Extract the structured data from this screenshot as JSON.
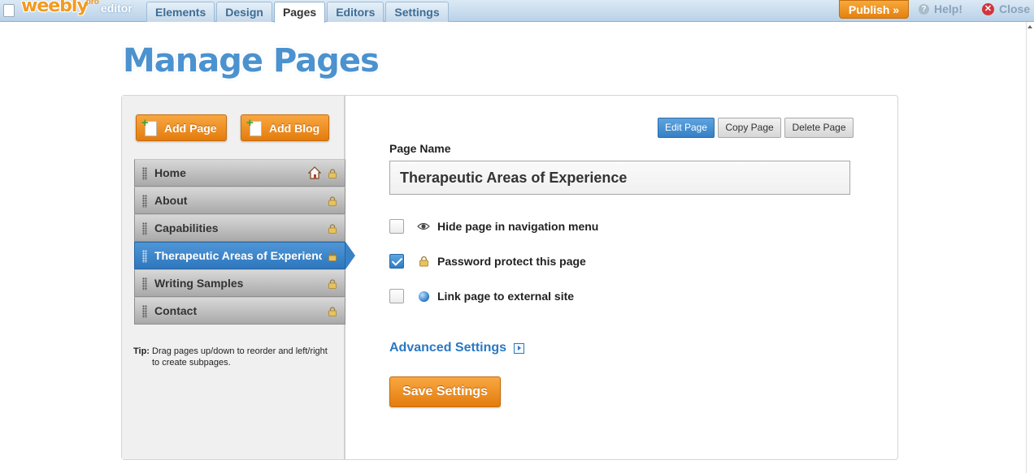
{
  "app": {
    "logo_text": "weebly",
    "logo_pro": "pro",
    "logo_editor": "editor",
    "tabs": [
      {
        "label": "Elements",
        "active": false
      },
      {
        "label": "Design",
        "active": false
      },
      {
        "label": "Pages",
        "active": true
      },
      {
        "label": "Editors",
        "active": false
      },
      {
        "label": "Settings",
        "active": false
      }
    ],
    "publish_label": "Publish »",
    "help_label": "Help!",
    "close_label": "Close"
  },
  "page_title": "Manage Pages",
  "sidebar": {
    "add_page_label": "Add Page",
    "add_blog_label": "Add Blog",
    "pages": [
      {
        "label": "Home",
        "home": true,
        "locked": true,
        "selected": false
      },
      {
        "label": "About",
        "home": false,
        "locked": true,
        "selected": false
      },
      {
        "label": "Capabilities",
        "home": false,
        "locked": true,
        "selected": false
      },
      {
        "label": "Therapeutic Areas of Experience",
        "home": false,
        "locked": true,
        "selected": true
      },
      {
        "label": "Writing Samples",
        "home": false,
        "locked": true,
        "selected": false
      },
      {
        "label": "Contact",
        "home": false,
        "locked": true,
        "selected": false
      }
    ],
    "tip_label": "Tip:",
    "tip_text": "Drag pages up/down to reorder and left/right to create subpages."
  },
  "editor": {
    "edit_page_label": "Edit Page",
    "copy_page_label": "Copy Page",
    "delete_page_label": "Delete Page",
    "page_name_label": "Page Name",
    "page_name_value": "Therapeutic Areas of Experience",
    "options": [
      {
        "label": "Hide page in navigation menu",
        "checked": false,
        "icon": "eye-icon"
      },
      {
        "label": "Password protect this page",
        "checked": true,
        "icon": "lock-icon"
      },
      {
        "label": "Link page to external site",
        "checked": false,
        "icon": "globe-icon"
      }
    ],
    "advanced_label": "Advanced Settings",
    "save_label": "Save Settings"
  },
  "colors": {
    "accent_orange": "#e9881a",
    "accent_blue": "#3a82c6",
    "title_blue": "#4b92cf"
  }
}
